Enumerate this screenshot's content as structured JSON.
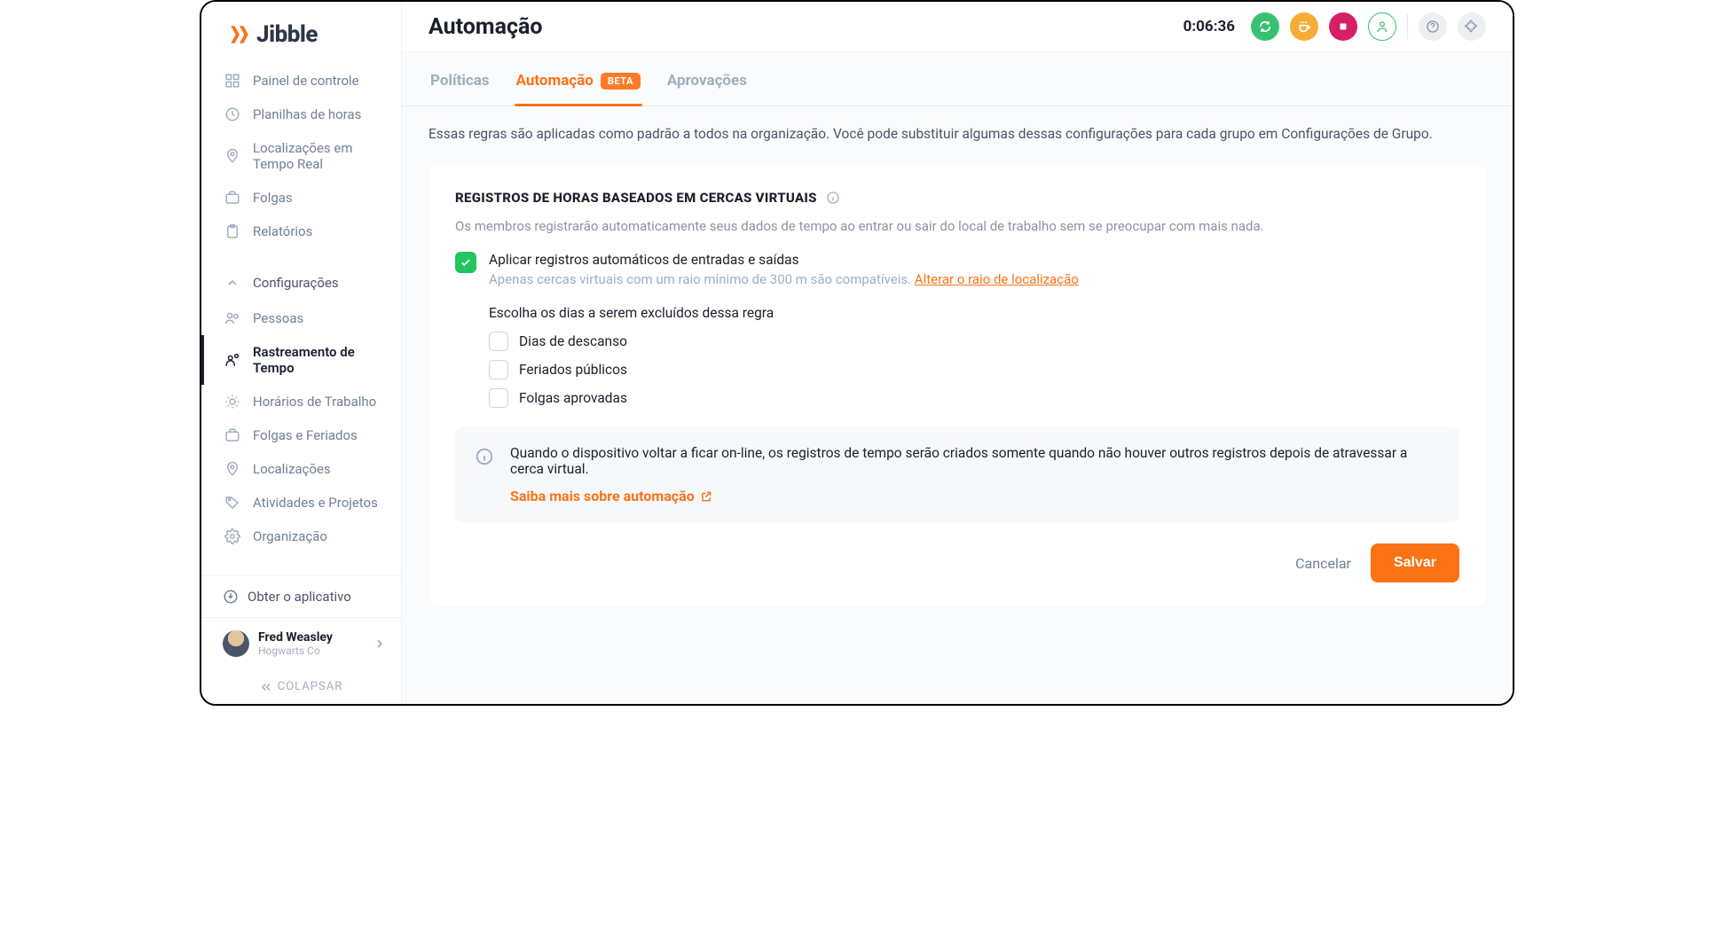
{
  "brand": "Jibble",
  "header": {
    "title": "Automação",
    "timer": "0:06:36"
  },
  "sidebar": {
    "items_top": [
      {
        "label": "Painel de controle"
      },
      {
        "label": "Planilhas de horas"
      },
      {
        "label": "Localizações em Tempo Real"
      },
      {
        "label": "Folgas"
      },
      {
        "label": "Relatórios"
      }
    ],
    "config_label": "Configurações",
    "items_bottom": [
      {
        "label": "Pessoas"
      },
      {
        "label": "Rastreamento de Tempo",
        "active": true
      },
      {
        "label": "Horários de Trabalho"
      },
      {
        "label": "Folgas e Feriados"
      },
      {
        "label": "Localizações"
      },
      {
        "label": "Atividades e Projetos"
      },
      {
        "label": "Organização"
      }
    ],
    "get_app": "Obter o aplicativo",
    "collapse": "COLAPSAR"
  },
  "user": {
    "name": "Fred Weasley",
    "org": "Hogwarts Co"
  },
  "tabs": [
    {
      "label": "Políticas"
    },
    {
      "label": "Automação",
      "badge": "BETA",
      "active": true
    },
    {
      "label": "Aprovações"
    }
  ],
  "page_description": "Essas regras são aplicadas como padrão a todos na organização. Você pode substituir algumas dessas configurações para cada grupo em Configurações de Grupo.",
  "section": {
    "title": "REGISTROS DE HORAS BASEADOS EM CERCAS VIRTUAIS",
    "subtitle": "Os membros registrarão automaticamente seus dados de tempo ao entrar ou sair do local de trabalho sem se preocupar com mais nada.",
    "apply": {
      "label": "Aplicar registros automáticos de entradas e saídas",
      "help_prefix": "Apenas cercas virtuais com um raio mínimo de 300 m são compatíveis. ",
      "help_link": "Alterar o raio de localização",
      "checked": true
    },
    "exclude_title": "Escolha os dias a serem excluídos dessa regra",
    "exclude_options": [
      {
        "label": "Dias de descanso",
        "checked": false
      },
      {
        "label": "Feriados públicos",
        "checked": false
      },
      {
        "label": "Folgas aprovadas",
        "checked": false
      }
    ],
    "info_text": "Quando o dispositivo voltar a ficar on-line, os registros de tempo serão criados somente quando não houver outros registros depois de atravessar a cerca virtual.",
    "info_link": "Saiba mais sobre automação"
  },
  "actions": {
    "cancel": "Cancelar",
    "save": "Salvar"
  }
}
